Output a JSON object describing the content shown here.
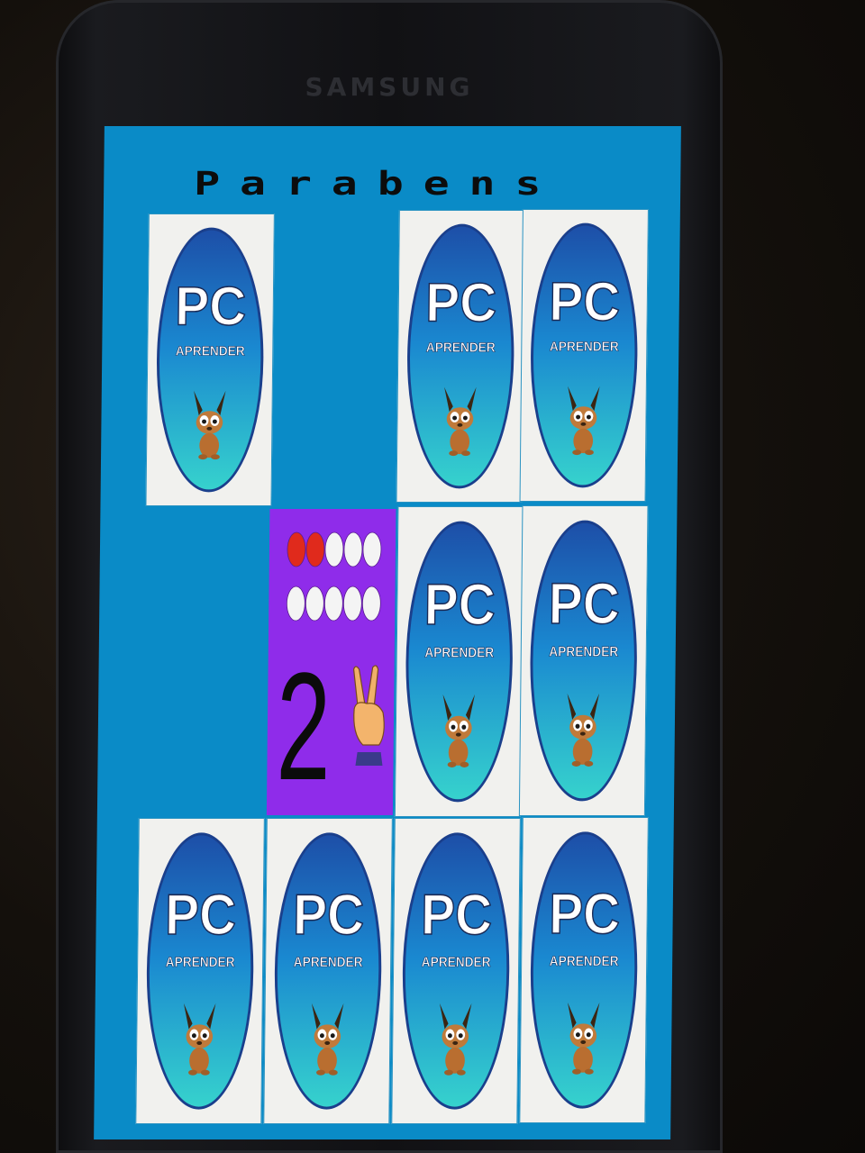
{
  "device": {
    "brand": "SAMSUNG"
  },
  "game": {
    "title": "Parabens",
    "card_back": {
      "big": "PC",
      "small": "APRENDER",
      "mascot": "dog-mascot-icon"
    },
    "revealed_card": {
      "number": "2",
      "dots_total": 10,
      "dots_filled": 2,
      "gesture": "two-fingers-hand-icon"
    },
    "colors": {
      "background": "#0a8bc7",
      "card_face": "#8f2cea",
      "dot_filled": "#e02a1c",
      "dot_empty": "#f4f4f4"
    }
  }
}
